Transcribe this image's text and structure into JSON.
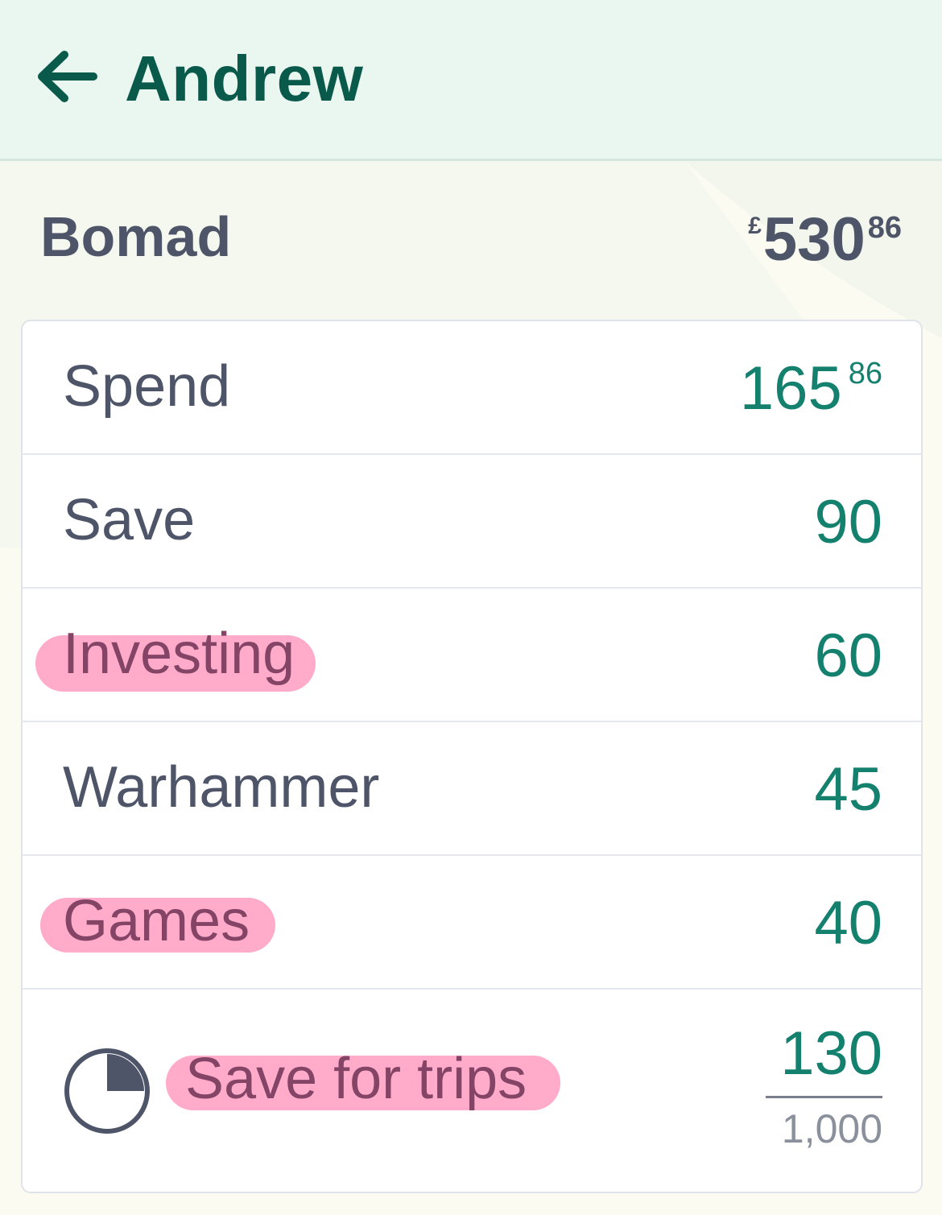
{
  "header": {
    "title": "Andrew",
    "back_icon": "arrow-left-icon"
  },
  "account": {
    "name": "Bomad",
    "balance": {
      "currency": "£",
      "main": "530",
      "minor": "86"
    }
  },
  "pots": [
    {
      "label": "Spend",
      "value": "165",
      "minor": "86",
      "highlighted": false
    },
    {
      "label": "Save",
      "value": "90",
      "minor": "",
      "highlighted": false
    },
    {
      "label": "Investing",
      "value": "60",
      "minor": "",
      "highlighted": true
    },
    {
      "label": "Warhammer",
      "value": "45",
      "minor": "",
      "highlighted": false
    },
    {
      "label": "Games",
      "value": "40",
      "minor": "",
      "highlighted": true
    }
  ],
  "goal_pot": {
    "label": "Save for trips",
    "current": "130",
    "target": "1,000",
    "progress_fraction": 0.13,
    "icon": "goal-progress-icon",
    "highlighted": true
  },
  "colors": {
    "header_bg": "#eaf6f0",
    "title": "#0a5a4b",
    "text": "#4e5568",
    "value": "#14806e",
    "highlight": "#ffabc9"
  }
}
